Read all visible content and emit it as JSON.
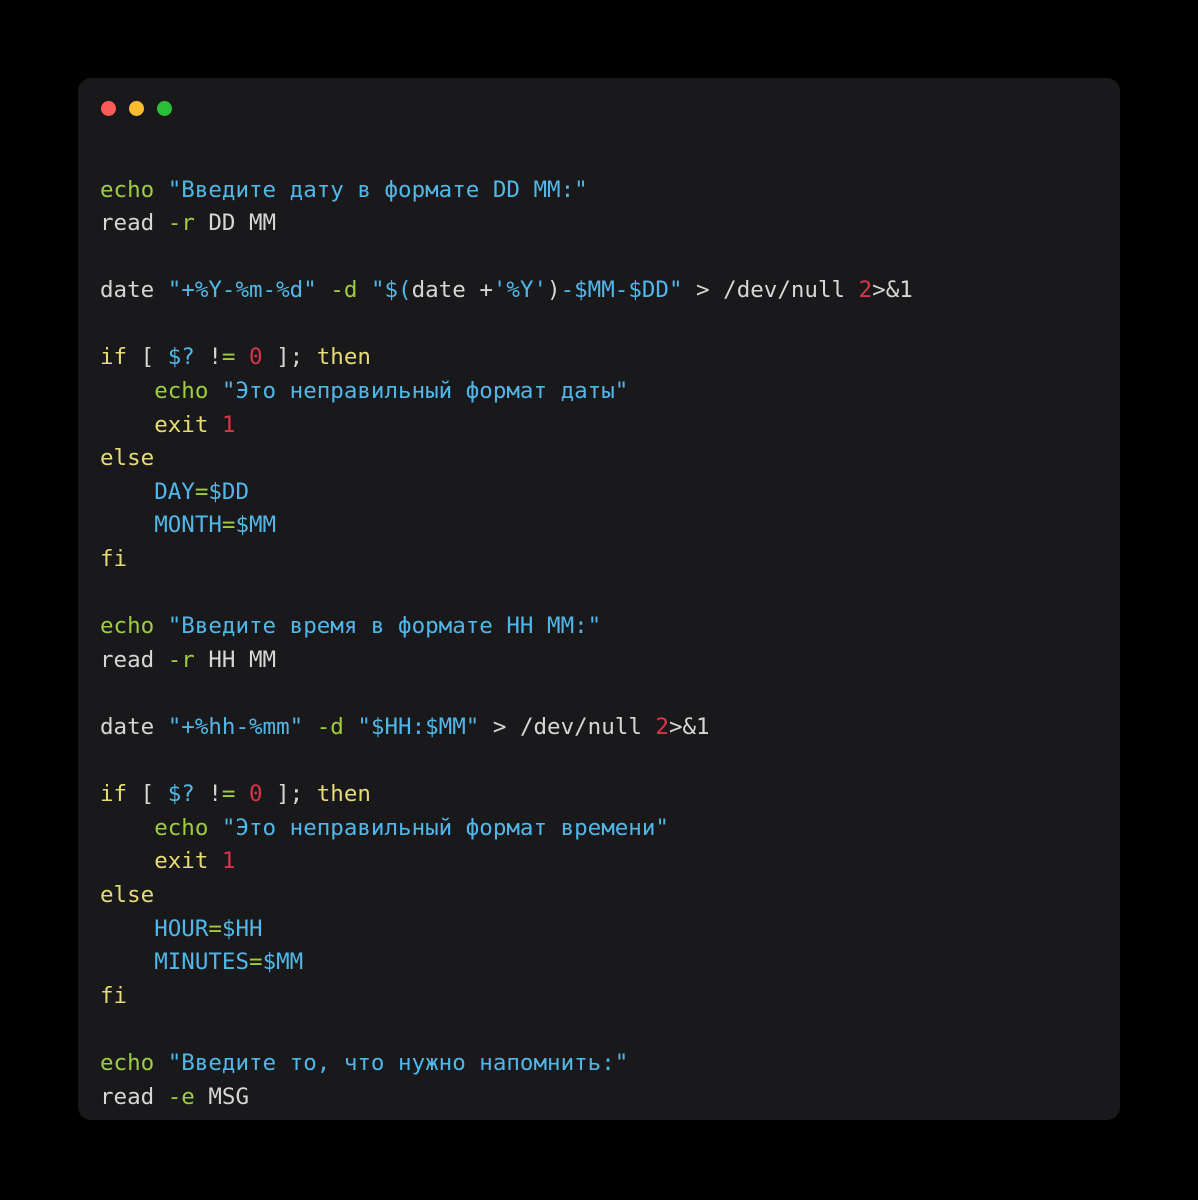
{
  "window": {
    "name": "code-snippet-window",
    "background": "#19191c",
    "page_background": "#000000",
    "traffic_lights": [
      {
        "name": "close",
        "color": "#fc5c57"
      },
      {
        "name": "minimize",
        "color": "#fcbb2f"
      },
      {
        "name": "zoom",
        "color": "#2ac035"
      }
    ]
  },
  "palette": {
    "plain": "#d6d6d6",
    "keyword": "#e6db74",
    "function": "#9ece3f",
    "string": "#51b7e8",
    "variable": "#51b7e8",
    "number": "#d9344a",
    "operator": "#9ece3f"
  },
  "code": {
    "language": "bash",
    "plain_text": "echo \"Введите дату в формате DD MM:\"\nread -r DD MM\n\ndate \"+%Y-%m-%d\" -d \"$(date +'%Y')-$MM-$DD\" > /dev/null 2>&1\n\nif [ $? != 0 ]; then\n    echo \"Это неправильный формат даты\"\n    exit 1\nelse\n    DAY=$DD\n    MONTH=$MM\nfi\n\necho \"Введите время в формате HH MM:\"\nread -r HH MM\n\ndate \"+%hh-%mm\" -d \"$HH:$MM\" > /dev/null 2>&1\n\nif [ $? != 0 ]; then\n    echo \"Это неправильный формат времени\"\n    exit 1\nelse\n    HOUR=$HH\n    MINUTES=$MM\nfi\n\necho \"Введите то, что нужно напомнить:\"\nread -e MSG",
    "lines": [
      {
        "n": 1,
        "tokens": [
          {
            "t": "echo",
            "c": "fn"
          },
          {
            "t": " ",
            "c": "plain"
          },
          {
            "t": "\"Введите дату в формате DD MM:\"",
            "c": "str"
          }
        ]
      },
      {
        "n": 2,
        "tokens": [
          {
            "t": "read ",
            "c": "plain"
          },
          {
            "t": "-r",
            "c": "flag"
          },
          {
            "t": " DD MM",
            "c": "plain"
          }
        ]
      },
      {
        "n": 3,
        "tokens": []
      },
      {
        "n": 4,
        "tokens": [
          {
            "t": "date ",
            "c": "plain"
          },
          {
            "t": "\"+%Y-%m-%d\"",
            "c": "str"
          },
          {
            "t": " ",
            "c": "plain"
          },
          {
            "t": "-d",
            "c": "flag"
          },
          {
            "t": " ",
            "c": "plain"
          },
          {
            "t": "\"$(",
            "c": "str"
          },
          {
            "t": "date ",
            "c": "plain"
          },
          {
            "t": "+",
            "c": "plain"
          },
          {
            "t": "'%Y'",
            "c": "str"
          },
          {
            "t": ")",
            "c": "plain"
          },
          {
            "t": "-$MM-$DD\"",
            "c": "str"
          },
          {
            "t": " > /dev/null ",
            "c": "plain"
          },
          {
            "t": "2",
            "c": "num"
          },
          {
            "t": ">&1",
            "c": "plain"
          }
        ]
      },
      {
        "n": 5,
        "tokens": []
      },
      {
        "n": 6,
        "tokens": [
          {
            "t": "if",
            "c": "kw"
          },
          {
            "t": " [ ",
            "c": "plain"
          },
          {
            "t": "$?",
            "c": "var"
          },
          {
            "t": " !",
            "c": "plain"
          },
          {
            "t": "=",
            "c": "op"
          },
          {
            "t": " ",
            "c": "plain"
          },
          {
            "t": "0",
            "c": "num"
          },
          {
            "t": " ]; ",
            "c": "plain"
          },
          {
            "t": "then",
            "c": "kw"
          }
        ]
      },
      {
        "n": 7,
        "tokens": [
          {
            "t": "    ",
            "c": "plain"
          },
          {
            "t": "echo",
            "c": "fn"
          },
          {
            "t": " ",
            "c": "plain"
          },
          {
            "t": "\"Это неправильный формат даты\"",
            "c": "str"
          }
        ]
      },
      {
        "n": 8,
        "tokens": [
          {
            "t": "    ",
            "c": "plain"
          },
          {
            "t": "exit",
            "c": "kw"
          },
          {
            "t": " ",
            "c": "plain"
          },
          {
            "t": "1",
            "c": "num"
          }
        ]
      },
      {
        "n": 9,
        "tokens": [
          {
            "t": "else",
            "c": "kw"
          }
        ]
      },
      {
        "n": 10,
        "tokens": [
          {
            "t": "    ",
            "c": "plain"
          },
          {
            "t": "DAY",
            "c": "var"
          },
          {
            "t": "=",
            "c": "op"
          },
          {
            "t": "$DD",
            "c": "var"
          }
        ]
      },
      {
        "n": 11,
        "tokens": [
          {
            "t": "    ",
            "c": "plain"
          },
          {
            "t": "MONTH",
            "c": "var"
          },
          {
            "t": "=",
            "c": "op"
          },
          {
            "t": "$MM",
            "c": "var"
          }
        ]
      },
      {
        "n": 12,
        "tokens": [
          {
            "t": "fi",
            "c": "kw"
          }
        ]
      },
      {
        "n": 13,
        "tokens": []
      },
      {
        "n": 14,
        "tokens": [
          {
            "t": "echo",
            "c": "fn"
          },
          {
            "t": " ",
            "c": "plain"
          },
          {
            "t": "\"Введите время в формате HH MM:\"",
            "c": "str"
          }
        ]
      },
      {
        "n": 15,
        "tokens": [
          {
            "t": "read ",
            "c": "plain"
          },
          {
            "t": "-r",
            "c": "flag"
          },
          {
            "t": " HH MM",
            "c": "plain"
          }
        ]
      },
      {
        "n": 16,
        "tokens": []
      },
      {
        "n": 17,
        "tokens": [
          {
            "t": "date ",
            "c": "plain"
          },
          {
            "t": "\"+%hh-%mm\"",
            "c": "str"
          },
          {
            "t": " ",
            "c": "plain"
          },
          {
            "t": "-d",
            "c": "flag"
          },
          {
            "t": " ",
            "c": "plain"
          },
          {
            "t": "\"$HH:$MM\"",
            "c": "str"
          },
          {
            "t": " > /dev/null ",
            "c": "plain"
          },
          {
            "t": "2",
            "c": "num"
          },
          {
            "t": ">&1",
            "c": "plain"
          }
        ]
      },
      {
        "n": 18,
        "tokens": []
      },
      {
        "n": 19,
        "tokens": [
          {
            "t": "if",
            "c": "kw"
          },
          {
            "t": " [ ",
            "c": "plain"
          },
          {
            "t": "$?",
            "c": "var"
          },
          {
            "t": " !",
            "c": "plain"
          },
          {
            "t": "=",
            "c": "op"
          },
          {
            "t": " ",
            "c": "plain"
          },
          {
            "t": "0",
            "c": "num"
          },
          {
            "t": " ]; ",
            "c": "plain"
          },
          {
            "t": "then",
            "c": "kw"
          }
        ]
      },
      {
        "n": 20,
        "tokens": [
          {
            "t": "    ",
            "c": "plain"
          },
          {
            "t": "echo",
            "c": "fn"
          },
          {
            "t": " ",
            "c": "plain"
          },
          {
            "t": "\"Это неправильный формат времени\"",
            "c": "str"
          }
        ]
      },
      {
        "n": 21,
        "tokens": [
          {
            "t": "    ",
            "c": "plain"
          },
          {
            "t": "exit",
            "c": "kw"
          },
          {
            "t": " ",
            "c": "plain"
          },
          {
            "t": "1",
            "c": "num"
          }
        ]
      },
      {
        "n": 22,
        "tokens": [
          {
            "t": "else",
            "c": "kw"
          }
        ]
      },
      {
        "n": 23,
        "tokens": [
          {
            "t": "    ",
            "c": "plain"
          },
          {
            "t": "HOUR",
            "c": "var"
          },
          {
            "t": "=",
            "c": "op"
          },
          {
            "t": "$HH",
            "c": "var"
          }
        ]
      },
      {
        "n": 24,
        "tokens": [
          {
            "t": "    ",
            "c": "plain"
          },
          {
            "t": "MINUTES",
            "c": "var"
          },
          {
            "t": "=",
            "c": "op"
          },
          {
            "t": "$MM",
            "c": "var"
          }
        ]
      },
      {
        "n": 25,
        "tokens": [
          {
            "t": "fi",
            "c": "kw"
          }
        ]
      },
      {
        "n": 26,
        "tokens": []
      },
      {
        "n": 27,
        "tokens": [
          {
            "t": "echo",
            "c": "fn"
          },
          {
            "t": " ",
            "c": "plain"
          },
          {
            "t": "\"Введите то, что нужно напомнить:\"",
            "c": "str"
          }
        ]
      },
      {
        "n": 28,
        "tokens": [
          {
            "t": "read ",
            "c": "plain"
          },
          {
            "t": "-e",
            "c": "flag"
          },
          {
            "t": " MSG",
            "c": "plain"
          }
        ]
      }
    ]
  }
}
